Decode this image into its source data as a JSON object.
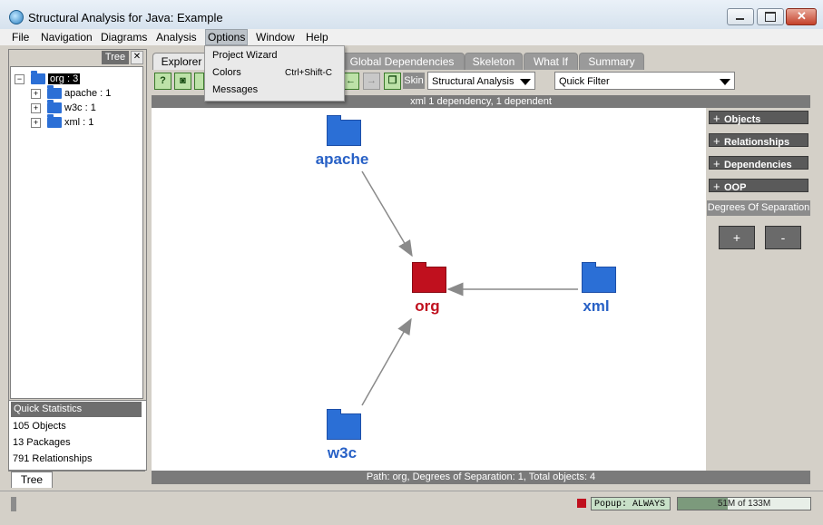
{
  "window": {
    "title": "Structural Analysis for Java: Example"
  },
  "menubar": [
    "File",
    "Navigation",
    "Diagrams",
    "Analysis",
    "Options",
    "Window",
    "Help"
  ],
  "options_menu": [
    {
      "label": "Project Wizard",
      "shortcut": ""
    },
    {
      "label": "Colors",
      "shortcut": "Ctrl+Shift-C"
    },
    {
      "label": "Messages",
      "shortcut": ""
    }
  ],
  "left_panel": {
    "header": "Tree",
    "root": "org : 3",
    "children": [
      "apache : 1",
      "w3c : 1",
      "xml : 1"
    ],
    "quick_stats": {
      "title": "Quick Statistics",
      "rows": [
        "105 Objects",
        "13 Packages",
        "791 Relationships"
      ]
    },
    "bottom_tab": "Tree"
  },
  "tabs": [
    "Explorer",
    "Global Dependencies",
    "Skeleton",
    "What If",
    "Summary"
  ],
  "toolbar": {
    "skin_label": "Skin",
    "skin_value": "Structural Analysis",
    "filter_value": "Quick Filter"
  },
  "info_text": "xml 1 dependency, 1 dependent",
  "graph": {
    "nodes": [
      {
        "id": "apache",
        "label": "apache",
        "color": "#2861c6"
      },
      {
        "id": "org",
        "label": "org",
        "color": "#c0101e"
      },
      {
        "id": "xml",
        "label": "xml",
        "color": "#2861c6"
      },
      {
        "id": "w3c",
        "label": "w3c",
        "color": "#2861c6"
      }
    ],
    "edges": [
      [
        "apache",
        "org"
      ],
      [
        "xml",
        "org"
      ],
      [
        "w3c",
        "org"
      ]
    ]
  },
  "right_panel": {
    "sections": [
      "Objects",
      "Relationships",
      "Dependencies",
      "OOP"
    ],
    "degrees_label": "Degrees Of Separation",
    "plus": "+",
    "minus": "-"
  },
  "status_text": "Path: org,  Degrees of Separation: 1, Total objects: 4",
  "bottom_status": {
    "popup": "Popup: ALWAYS",
    "memory": "51M of 133M",
    "memory_fraction": 0.38
  },
  "colors": {
    "accent_blue": "#2b6fd6",
    "focus_red": "#c0101e"
  }
}
